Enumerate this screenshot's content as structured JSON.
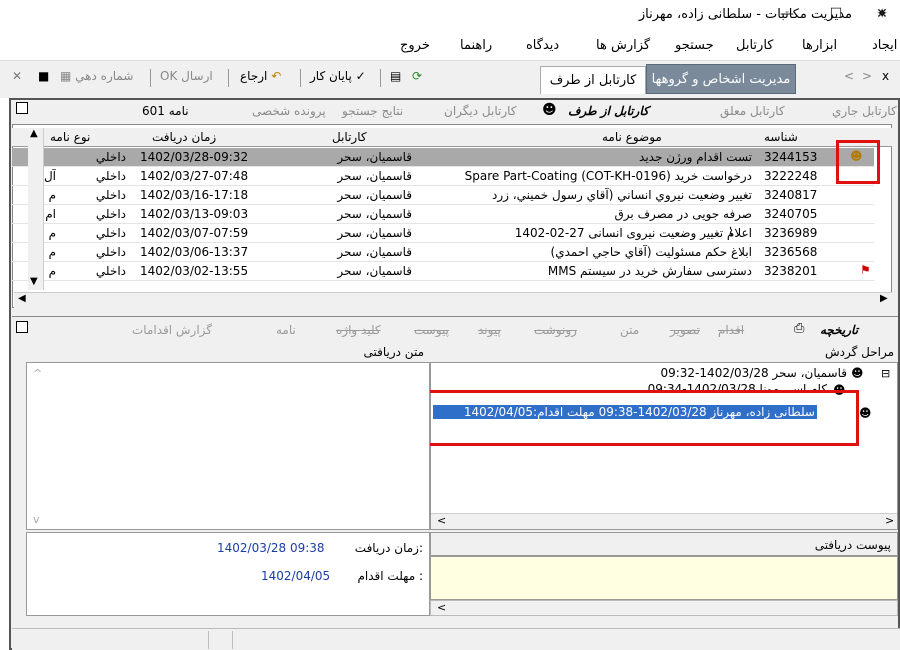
{
  "window": {
    "title": "مدیریت مکاتبات - سلطانی زاده، مهرناز",
    "controls": [
      "—",
      "☐",
      "✕"
    ]
  },
  "menu": [
    "ایجاد",
    "ابزارها",
    "کارتابل",
    "جستجو",
    "گزارش ها",
    "دیدگاه",
    "راهنما",
    "خروج"
  ],
  "toolbar": {
    "return_label": "ارجاع",
    "finish_label": "پایان کار",
    "send_label": "ارسال",
    "ok_label": "OK",
    "number_label": "شماره دهي",
    "tab_people": "مدیریت اشخاص و گروهها",
    "tab_from": "کارتابل از طرف"
  },
  "inbox_tabs": [
    "کارتابل جاري",
    "کارتابل معلق",
    "کارتابل از طرف",
    "کارتابل دیگران",
    "نتایج جستجو",
    "پرونده شخصی",
    "601 نامه"
  ],
  "grid": {
    "headers": {
      "number": "شناسه",
      "subject": "موضوع نامه",
      "cartable": "کارتابل",
      "receive_time": "زمان دریافت",
      "type": "نوع نامه"
    },
    "rows": [
      {
        "number": "3244153",
        "subject": "تست اقدام ورژن جدید",
        "cartable": "قاسمیان، سحر",
        "receive_time": "1402/03/28-09:32",
        "type": "داخلي",
        "extra": ""
      },
      {
        "number": "3222248",
        "subject": "درخواست خرید (Spare Part-Coating (COT-KH-0196",
        "cartable": "قاسمیان، سحر",
        "receive_time": "1402/03/27-07:48",
        "type": "داخلي",
        "extra": "آل"
      },
      {
        "number": "3240817",
        "subject": "تغییر وضعیت نیروي انساني (آقاي رسول خمیني، زرد",
        "cartable": "قاسمیان، سحر",
        "receive_time": "1402/03/16-17:18",
        "type": "داخلي",
        "extra": "م"
      },
      {
        "number": "3240705",
        "subject": "صرفه جویی در مصرف برق",
        "cartable": "قاسمیان، سحر",
        "receive_time": "1402/03/13-09:03",
        "type": "داخلي",
        "extra": "ام"
      },
      {
        "number": "3236989",
        "subject": "اعلام تغییر وضعیت نیروی انسانی 27-02-1402",
        "cartable": "قاسمیان، سحر",
        "receive_time": "1402/03/07-07:59",
        "type": "داخلي",
        "extra": "م"
      },
      {
        "number": "3236568",
        "subject": "ابلاغ حکم مسئولیت (آقاي حاجي احمدي)",
        "cartable": "قاسمیان، سحر",
        "receive_time": "1402/03/06-13:37",
        "type": "داخلي",
        "extra": "م"
      },
      {
        "number": "3238201",
        "subject": "دسترسی سفارش خرید در سیستم MMS",
        "cartable": "قاسمیان، سحر",
        "receive_time": "1402/03/02-13:55",
        "type": "داخلي",
        "extra": "م"
      }
    ]
  },
  "lower_tabs": [
    "تاریخچه",
    "اقدام",
    "تصویر",
    "متن",
    "رونوشت",
    "پیوند",
    "پیوست",
    "کلید واژه",
    "نامه",
    "گزارش اقدامات"
  ],
  "routes": {
    "header": "مراحل گردش",
    "nodes": [
      "قاسمیان، سحر  1402/03/28-09:32",
      "کام اسی مونا  1402/03/28-09:34",
      "سلطانی زاده، مهرناز  1402/03/28-09:38  مهلت اقدام:1402/04/05"
    ]
  },
  "text_panel": {
    "header": "متن دریافتی"
  },
  "info": {
    "receive_label": "زمان دریافت:",
    "receive_value": "1402/03/28  09:38",
    "deadline_label": "مهلت اقدام :",
    "deadline_value": "1402/04/05"
  },
  "attachments": {
    "header": "پیوست دریافتی"
  },
  "colors": {
    "highlight": "#e01010",
    "selected_row": "#a9a9a9",
    "node_selected": "#2f6fc9"
  }
}
